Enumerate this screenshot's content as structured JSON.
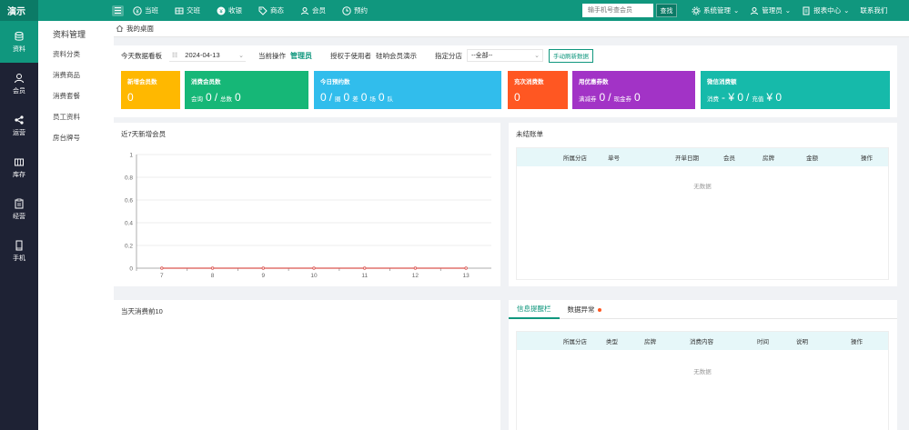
{
  "brand": "演示",
  "nav": [
    "当班",
    "交班",
    "收银",
    "商态",
    "会员",
    "预约"
  ],
  "search": {
    "placeholder": "输手机号查会员",
    "button": "查找"
  },
  "top_right": [
    "系统管理",
    "管理员",
    "报表中心",
    "联系我们"
  ],
  "iconbar": [
    {
      "label": "资料",
      "icon": "database-icon"
    },
    {
      "label": "会员",
      "icon": "user-icon"
    },
    {
      "label": "运营",
      "icon": "share-icon"
    },
    {
      "label": "库存",
      "icon": "warehouse-icon"
    },
    {
      "label": "经营",
      "icon": "clipboard-icon"
    },
    {
      "label": "手机",
      "icon": "phone-icon"
    }
  ],
  "submenu": {
    "title": "资料管理",
    "items": [
      "资料分类",
      "消费商品",
      "消费套餐",
      "员工资料",
      "房台牌号"
    ]
  },
  "breadcrumb": "我的桌面",
  "dash": {
    "label_board": "今天数据看板",
    "date": "2024-04-13",
    "label_operator": "当前操作",
    "operator": "管理员",
    "label_auth": "授权于使用者",
    "auth_value": "硅响会员演示",
    "label_branch": "指定分店",
    "branch": "--全部--",
    "refresh": "手动刷新数据"
  },
  "cards": {
    "new_members": {
      "title": "新增会员数",
      "value": "0",
      "color": "#ffb800"
    },
    "consume_members": {
      "title": "消费会员数",
      "l1": "会询",
      "v1": "0",
      "sep": "/",
      "l2": "总数",
      "v2": "0",
      "color": "#16b777"
    },
    "reservations": {
      "title": "今日预约数",
      "v1": "0",
      "sep": "/",
      "l1": "圈",
      "v2": "0",
      "l2": "差",
      "v3": "0",
      "l3": "场",
      "v4": "0",
      "l4": "队",
      "color": "#31bdec"
    },
    "recharge": {
      "title": "充次消费数",
      "value": "0",
      "color": "#ff5722"
    },
    "coupons": {
      "title": "用优惠券数",
      "l1": "满减券",
      "v1": "0",
      "sep": "/",
      "l2": "现金券",
      "v2": "0",
      "color": "#a233c6"
    },
    "wechat": {
      "title": "微信消费额",
      "l1": "消费",
      "v1": "- ¥ 0",
      "sep": "/",
      "l2": "充值",
      "v2": "¥ 0",
      "color": "#16baaa"
    }
  },
  "chart_panel_title": "近7天新增会员",
  "chart_data": {
    "type": "line",
    "title": "",
    "categories": [
      "7",
      "8",
      "9",
      "10",
      "11",
      "12",
      "13"
    ],
    "series": [
      {
        "values": [
          0,
          0,
          0,
          0,
          0,
          0,
          0
        ],
        "color": "#d9534f"
      }
    ],
    "ylim": [
      0,
      1
    ],
    "yticks": [
      "0",
      "0.2",
      "0.4",
      "0.6",
      "0.8",
      "1"
    ],
    "grid": true
  },
  "unsettled": {
    "title": "未结账单",
    "columns": [
      "所属分店",
      "单号",
      "开单日期",
      "会员",
      "房牌",
      "金额",
      "操作"
    ],
    "empty": "无数据"
  },
  "top10_title": "当天消费前10",
  "info": {
    "tabs": [
      "信息提醒栏",
      "数据异常"
    ],
    "columns": [
      "所属分店",
      "类型",
      "房牌",
      "消费内容",
      "时间",
      "说明",
      "操作"
    ],
    "empty": "无数据"
  }
}
